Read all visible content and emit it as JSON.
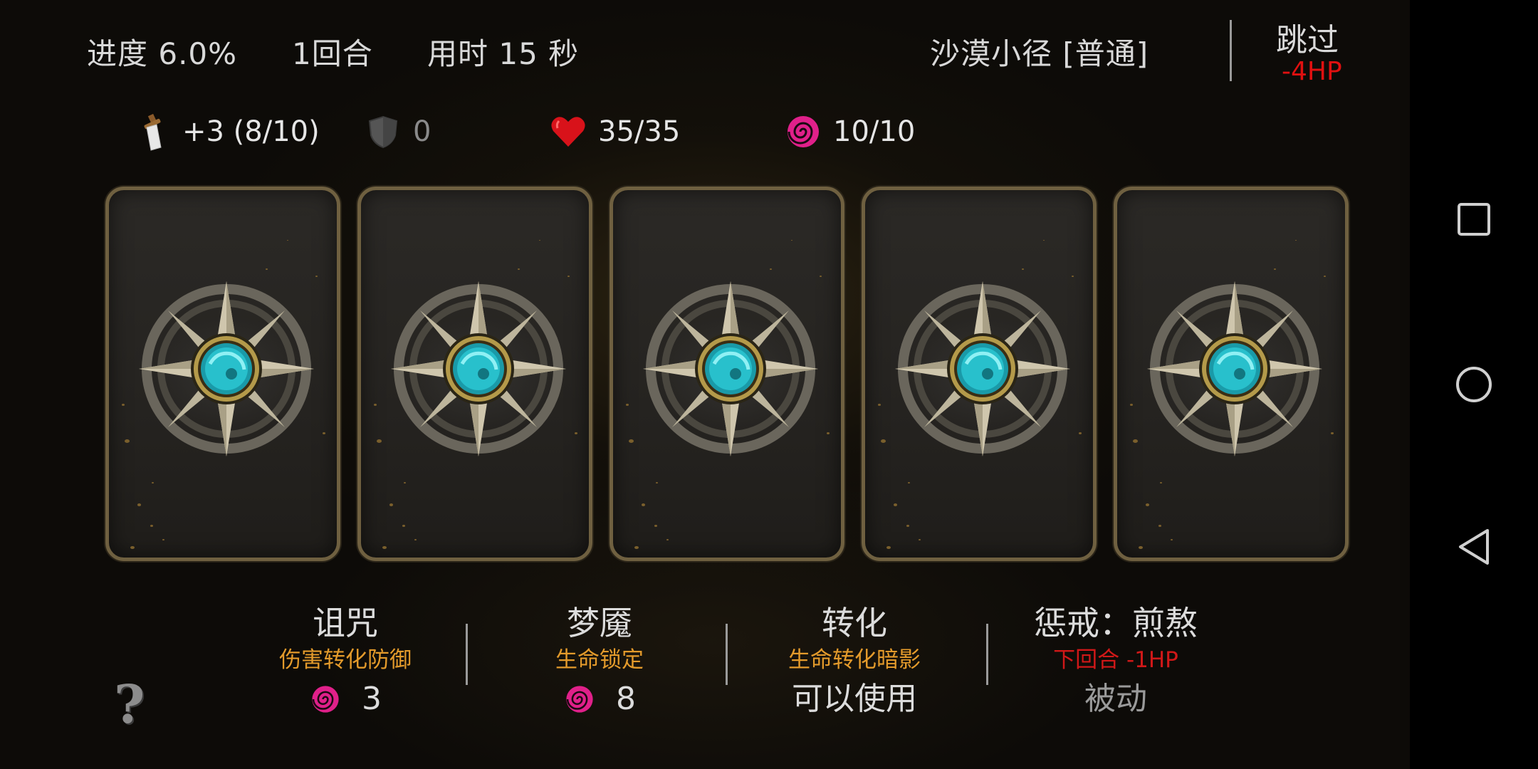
{
  "hud": {
    "progress": "进度 6.0%",
    "round": "1回合",
    "time": "用时 15 秒",
    "location": "沙漠小径 [普通]",
    "skip_label": "跳过",
    "skip_cost": "-4HP"
  },
  "stats": {
    "attack": "+3 (8/10)",
    "armor": "0",
    "health": "35/35",
    "mana": "10/10"
  },
  "cards": [
    {
      "icon": "compass-orb-icon"
    },
    {
      "icon": "compass-orb-icon"
    },
    {
      "icon": "compass-orb-icon"
    },
    {
      "icon": "compass-orb-icon"
    },
    {
      "icon": "compass-orb-icon"
    }
  ],
  "skills": [
    {
      "name": "诅咒",
      "desc": "伤害转化防御",
      "cost": "3"
    },
    {
      "name": "梦魇",
      "desc": "生命锁定",
      "cost": "8"
    },
    {
      "name": "转化",
      "desc": "生命转化暗影",
      "cost": "可以使用"
    },
    {
      "name": "惩戒：煎熬",
      "desc": "下回合 -1HP",
      "cost": "被动"
    }
  ],
  "help_label": "?",
  "colors": {
    "accent_orange": "#e39a2b",
    "danger_red": "#e01010",
    "mana_magenta": "#e0208a",
    "card_border": "#6f6040"
  }
}
